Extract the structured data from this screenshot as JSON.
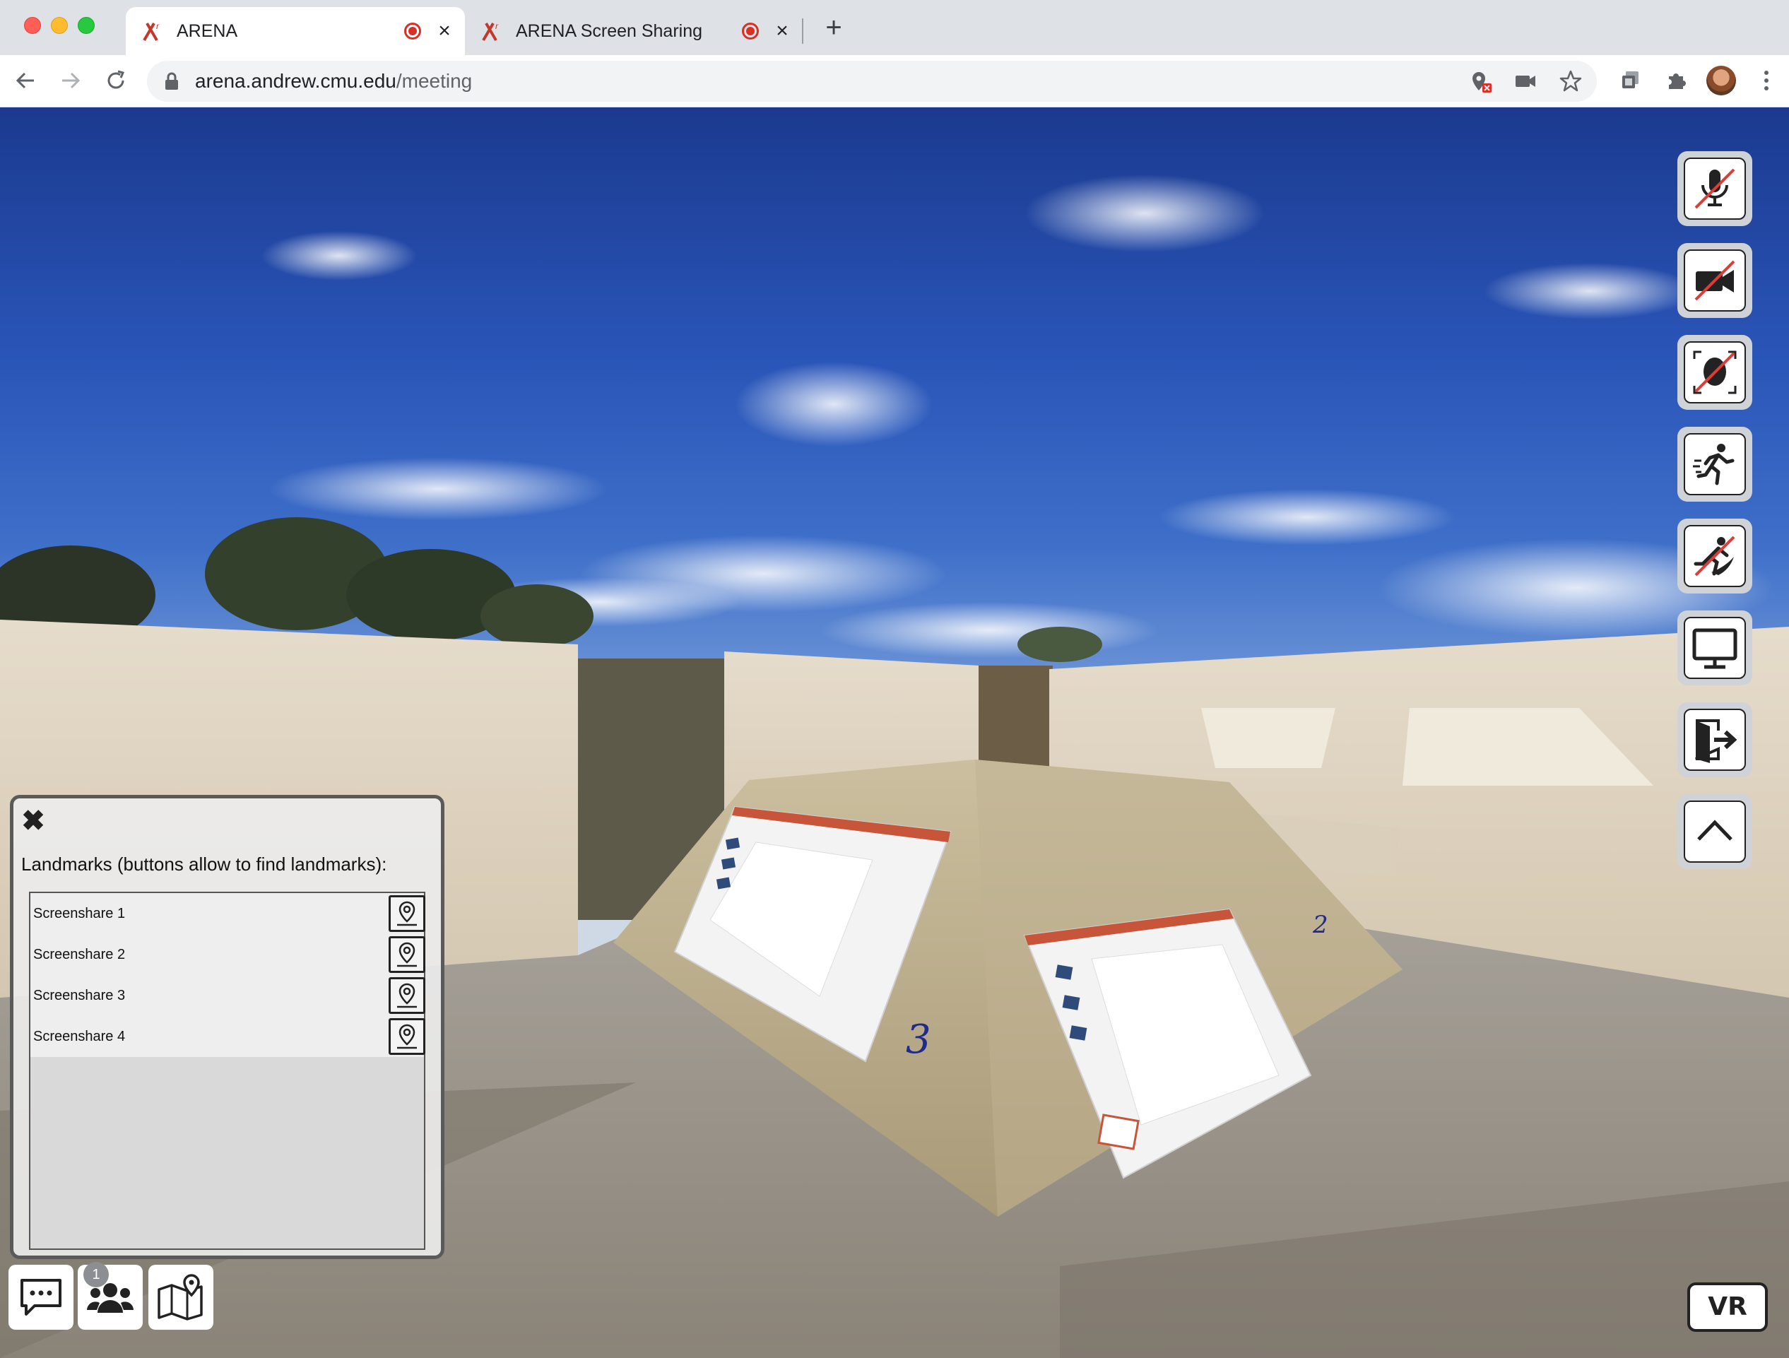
{
  "browser": {
    "tabs": [
      {
        "label": "ARENA",
        "active": true,
        "recording": true
      },
      {
        "label": "ARENA Screen Sharing",
        "active": false,
        "recording": true
      }
    ],
    "url": {
      "host": "arena.andrew.cmu.edu",
      "path": "/meeting"
    },
    "icons": {
      "back": "arrow-left-icon",
      "forward": "arrow-right-icon",
      "reload": "reload-icon",
      "lock": "lock-icon",
      "location_blocked": "location-blocked-icon",
      "camera": "camera-icon",
      "bookmark": "star-icon",
      "tab_search": "tab-search-icon",
      "extensions": "puzzle-icon",
      "profile": "avatar",
      "menu": "kebab-menu-icon"
    }
  },
  "scene": {
    "labels": {
      "screen_3": "3",
      "screen_2": "2"
    }
  },
  "controls": {
    "right": [
      {
        "name": "microphone-off",
        "icon": "microphone-muted-icon"
      },
      {
        "name": "video-off",
        "icon": "video-muted-icon"
      },
      {
        "name": "avatar-off",
        "icon": "face-tracking-off-icon"
      },
      {
        "name": "fly-mode",
        "icon": "running-person-icon"
      },
      {
        "name": "speed-mode",
        "icon": "speed-off-icon"
      },
      {
        "name": "screen-share",
        "icon": "monitor-icon"
      },
      {
        "name": "exit",
        "icon": "exit-door-icon"
      },
      {
        "name": "collapse",
        "icon": "chevron-up-icon"
      }
    ],
    "vr_label": "VR"
  },
  "landmarks": {
    "title": "Landmarks (buttons allow to find landmarks):",
    "close_glyph": "✖",
    "items": [
      {
        "label": "Screenshare 1"
      },
      {
        "label": "Screenshare 2"
      },
      {
        "label": "Screenshare 3"
      },
      {
        "label": "Screenshare 4"
      }
    ]
  },
  "bottom_buttons": {
    "chat_icon": "chat-bubble-icon",
    "users_icon": "users-icon",
    "users_badge": "1",
    "landmarks_icon": "map-pin-icon"
  },
  "colors": {
    "recording": "#d93025",
    "arena_logo": "#c0392b",
    "mute_slash": "#e53935"
  }
}
